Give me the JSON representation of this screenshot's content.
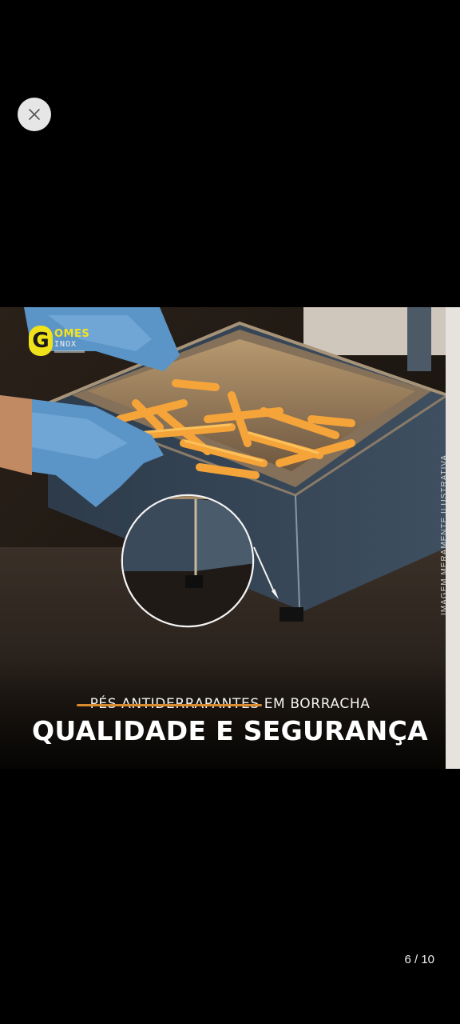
{
  "viewer": {
    "close_icon": "close-icon",
    "page_counter": "6 / 10"
  },
  "image": {
    "logo": {
      "initial": "G",
      "line1": "OMES",
      "line2": "INOX"
    },
    "side_note": "IMAGEM MERAMENTE ILUSTRATIVA",
    "subtitle": "PÉS ANTIDERRAPANTES EM BORRACHA",
    "headline": "QUALIDADE E SEGURANÇA",
    "colors": {
      "accent": "#d88a2c",
      "logo_yellow": "#f0e21a"
    }
  }
}
